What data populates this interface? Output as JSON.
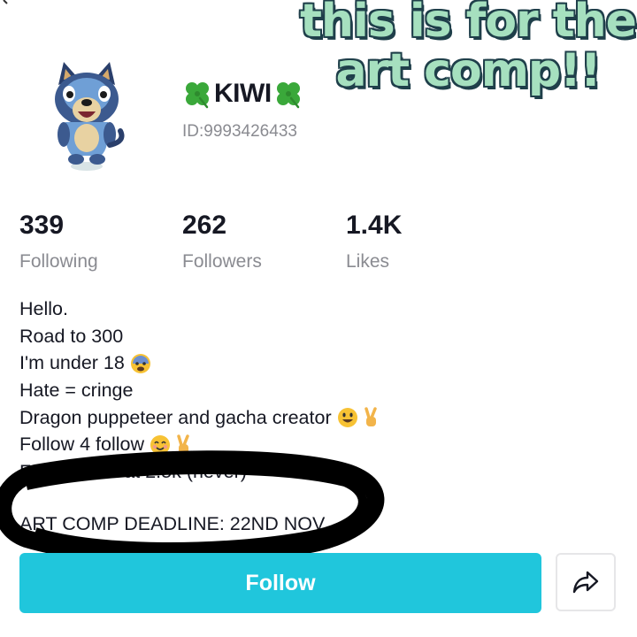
{
  "overlay_caption": "this is for the art comp!!",
  "profile": {
    "display_name": "KIWI",
    "user_id": "ID:9993426433",
    "name_icon": "four-leaf-clover-icon",
    "avatar_icon": "cartoon-dog-avatar"
  },
  "stats": [
    {
      "value": "339",
      "label": "Following"
    },
    {
      "value": "262",
      "label": "Followers"
    },
    {
      "value": "1.4K",
      "label": "Likes"
    }
  ],
  "bio": {
    "lines": [
      {
        "text": "Hello."
      },
      {
        "text": "Road to 300"
      },
      {
        "text": "I'm under 18",
        "emoji": "anxious-face-icon"
      },
      {
        "text": "Hate = cringe"
      },
      {
        "text": "Dragon puppeteer and gacha creator",
        "emoji": "smiley-face-and-victory-hand-icon"
      },
      {
        "text": "Follow 4 follow",
        "emoji": "smiling-face-and-victory-hand-icon"
      },
      {
        "text": "Face reveal at 2.5k (never)"
      }
    ],
    "deadline": "ART COMP DEADLINE: 22ND NOV"
  },
  "actions": {
    "follow_label": "Follow",
    "share_icon": "share-arrow-icon"
  },
  "colors": {
    "follow_button": "#20c6dc",
    "overlay_text": "#a6e0bf",
    "overlay_outline": "#1f3f4a",
    "scribble": "#000000"
  }
}
